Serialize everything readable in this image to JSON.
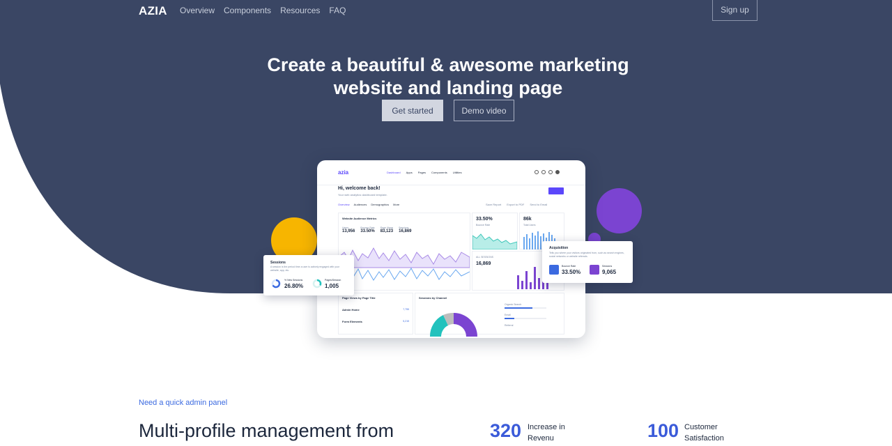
{
  "nav": {
    "logo": "AZIA",
    "links": [
      "Overview",
      "Components",
      "Resources",
      "FAQ"
    ],
    "signup": "Sign up"
  },
  "hero": {
    "headline_line1": "Create a beautiful & awesome marketing",
    "headline_line2": "website and landing page",
    "primary_cta": "Get started",
    "secondary_cta": "Demo video"
  },
  "mockup": {
    "logo": "azia",
    "nav": [
      "Dashboard",
      "Apps",
      "Pages",
      "Components",
      "Utilities"
    ],
    "welcome": "Hi, welcome back!",
    "subtitle": "Your web analytics dashboard template.",
    "tabs": [
      "Overview",
      "Audiences",
      "Demographics",
      "More"
    ],
    "right_links": [
      "Save Report",
      "Export to PDF",
      "Send to Email"
    ],
    "audience_title": "Website Audience Metrics",
    "metrics": [
      {
        "label": "Users",
        "value": "13,956"
      },
      {
        "label": "Bounce Rate",
        "value": "33.50%"
      },
      {
        "label": "Page Views",
        "value": "83,123"
      },
      {
        "label": "Sessions",
        "value": "16,869"
      }
    ],
    "bounce_value": "33.50%",
    "bounce_label": "Bounce Rate",
    "total_users_value": "86k",
    "total_users_label": "Total Users",
    "all_sessions_label": "ALL SESSIONS",
    "all_sessions_value": "16,869",
    "page_views_title": "Page Views by Page Title",
    "pages": [
      {
        "name": "Admin Home",
        "value": "7,755"
      },
      {
        "name": "Form Elements",
        "value": "5,215"
      }
    ],
    "channel_title": "Sessions by Channel",
    "channels": [
      "Organic Search",
      "Email",
      "Referral"
    ]
  },
  "sessions_card": {
    "title": "Sessions",
    "description": "A session is the period time a user is actively engaged with your website, app, etc.",
    "stat1_label": "% New Sessions",
    "stat1_value": "26.80%",
    "stat2_label": "Pages/Session",
    "stat2_value": "1,005"
  },
  "acquisition_card": {
    "title": "Acquisition",
    "description": "Tells you where your visitors originated from, such as search engines, social networks or website referrals.",
    "stat1_label": "Bounce Rate",
    "stat1_value": "33.50%",
    "stat2_label": "Sessions",
    "stat2_value": "9,065"
  },
  "section": {
    "eyebrow": "Need a quick admin panel",
    "title": "Multi-profile management from",
    "stat1_number": "320",
    "stat1_label_line1": "Increase in",
    "stat1_label_line2": "Revenu",
    "stat2_number": "100",
    "stat2_label_line1": "Customer",
    "stat2_label_line2": "Satisfaction"
  },
  "colors": {
    "hero_bg": "#3a4664",
    "accent_blue": "#3b5bd9",
    "accent_purple": "#7b44d1",
    "accent_yellow": "#f7b500"
  }
}
